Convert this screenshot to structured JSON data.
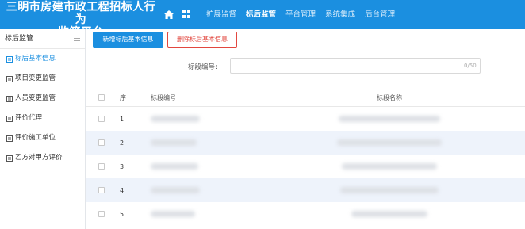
{
  "header": {
    "title_line1": "三明市房建市政工程招标人行为",
    "title_line2": "监管平台",
    "nav": [
      {
        "label": "扩展监督",
        "active": false
      },
      {
        "label": "标后监管",
        "active": true
      },
      {
        "label": "平台管理",
        "active": false
      },
      {
        "label": "系统集成",
        "active": false
      },
      {
        "label": "后台管理",
        "active": false
      }
    ],
    "icons": [
      "home-icon",
      "grid-icon"
    ]
  },
  "sidebar": {
    "title": "标后监管",
    "items": [
      {
        "label": "标后基本信息",
        "active": true
      },
      {
        "label": "项目变更监管",
        "active": false
      },
      {
        "label": "人员变更监管",
        "active": false
      },
      {
        "label": "评价代理",
        "active": false
      },
      {
        "label": "评价施工单位",
        "active": false
      },
      {
        "label": "乙方对甲方评价",
        "active": false
      }
    ]
  },
  "toolbar": {
    "add_label": "新增标后基本信息",
    "delete_label": "删除标后基本信息"
  },
  "search": {
    "label": "标段编号:",
    "value": "",
    "counter": "0/50"
  },
  "table": {
    "headers": {
      "index": "序",
      "code": "标段编号",
      "name": "标段名称"
    },
    "rows": [
      {
        "index": "1"
      },
      {
        "index": "2"
      },
      {
        "index": "3"
      },
      {
        "index": "4"
      },
      {
        "index": "5"
      }
    ]
  },
  "colors": {
    "primary": "#1b8fe0",
    "danger": "#e2473f",
    "row_alt": "#eef3fb"
  }
}
